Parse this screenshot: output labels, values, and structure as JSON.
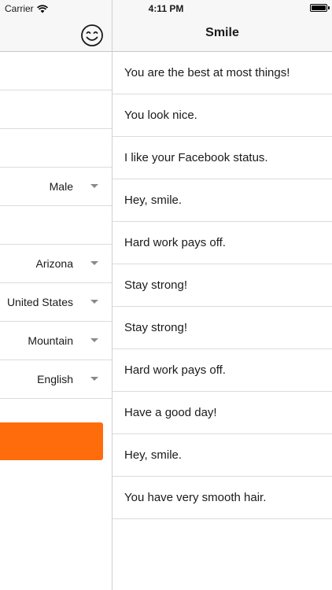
{
  "status_bar": {
    "carrier": "Carrier",
    "time": "4:11 PM",
    "wifi_icon": "wifi-icon",
    "battery_level": 1.0
  },
  "left_panel": {
    "nav_icon": "smiley-face-icon",
    "rows": [
      {
        "value": ""
      },
      {
        "value": ""
      },
      {
        "value": ""
      },
      {
        "value": "Male",
        "dropdown": true
      },
      {
        "value": ""
      },
      {
        "value": "Arizona",
        "dropdown": true
      },
      {
        "value": "United States",
        "dropdown": true
      },
      {
        "value": "Mountain",
        "dropdown": true
      },
      {
        "value": "English",
        "dropdown": true
      }
    ],
    "submit_color": "#ff6c0c"
  },
  "right_panel": {
    "title": "Smile",
    "messages": [
      "You are the best at most things!",
      "You look nice.",
      "I like your Facebook status.",
      "Hey, smile.",
      "Hard work pays off.",
      "Stay strong!",
      "Stay strong!",
      "Hard work pays off.",
      "Have a good day!",
      "Hey, smile.",
      "You have very smooth hair."
    ]
  },
  "colors": {
    "accent": "#ff6c0c",
    "nav_background": "#f7f7f7",
    "separator": "#dcdcdc"
  }
}
